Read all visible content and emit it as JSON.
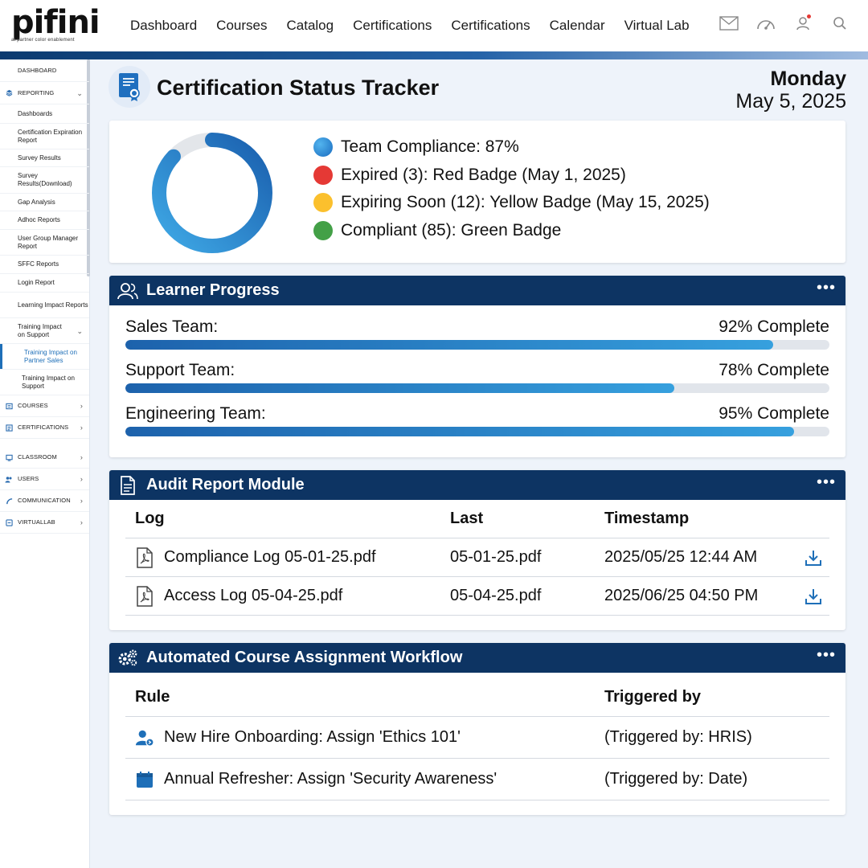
{
  "brand": {
    "logo": "pifini",
    "tagline": "at partner color enablement"
  },
  "nav": {
    "items": [
      "Dashboard",
      "Courses",
      "Catalog",
      "Certifications",
      "Certifications",
      "Calendar",
      "Virtual Lab"
    ],
    "icons": [
      "mail-icon",
      "gauge-icon",
      "user-icon",
      "search-icon"
    ]
  },
  "sidebar": {
    "items": [
      {
        "label": "DASHBOARD",
        "type": "section"
      },
      {
        "label": "REPORTING",
        "type": "section",
        "icon": "layers-icon",
        "chevron": "⌄"
      },
      {
        "label": "Dashboards",
        "type": "sub"
      },
      {
        "label": "Certification Expiration Report",
        "type": "sub"
      },
      {
        "label": "Survey Results",
        "type": "sub"
      },
      {
        "label": "Survey Results(Download)",
        "type": "sub"
      },
      {
        "label": "Gap Analysis",
        "type": "sub"
      },
      {
        "label": "Adhoc Reports",
        "type": "sub"
      },
      {
        "label": "User Group Manager Report",
        "type": "sub"
      },
      {
        "label": "SFFC Reports",
        "type": "sub"
      },
      {
        "label": "Login Report",
        "type": "sub"
      },
      {
        "label": "Learning Impact Reports",
        "type": "sub"
      },
      {
        "label": "Training Impact on Support",
        "type": "sub",
        "chevron": "⌄"
      },
      {
        "label": "Training Impact on Partner Sales",
        "type": "subsub",
        "active": true
      },
      {
        "label": "Training Impact on Support",
        "type": "subsub2"
      },
      {
        "label": "COURSES",
        "type": "section",
        "icon": "courses-icon",
        "chevron": "›"
      },
      {
        "label": "CERTIFICATIONS",
        "type": "section",
        "icon": "cert-icon",
        "chevron": "›"
      },
      {
        "label": "CLASSROOM",
        "type": "section",
        "icon": "classroom-icon",
        "chevron": "›"
      },
      {
        "label": "USERS",
        "type": "section",
        "icon": "users-icon",
        "chevron": "›"
      },
      {
        "label": "COMMUNICATION",
        "type": "section",
        "icon": "comm-icon",
        "chevron": "›"
      },
      {
        "label": "VIRTUALLAB",
        "type": "section",
        "icon": "lab-icon",
        "chevron": "›"
      }
    ]
  },
  "header": {
    "title": "Certification Status Tracker",
    "day": "Monday",
    "date": "May 5, 2025"
  },
  "compliance": {
    "percent": 87,
    "legend": [
      {
        "text": "Team Compliance: 87%",
        "color": "#1e7fcf"
      },
      {
        "text": "Expired (3): Red Badge (May 1, 2025)",
        "color": "#e53935"
      },
      {
        "text": "Expiring Soon (12): Yellow Badge (May 15, 2025)",
        "color": "#fbc02d"
      },
      {
        "text": "Compliant (85): Green Badge",
        "color": "#43a047"
      }
    ]
  },
  "progress": {
    "title": "Learner Progress",
    "rows": [
      {
        "team": "Sales Team:",
        "status": "92% Complete",
        "value": 92
      },
      {
        "team": "Support Team:",
        "status": "78% Complete",
        "value": 78
      },
      {
        "team": "Engineering Team:",
        "status": "95% Complete",
        "value": 95
      }
    ]
  },
  "audit": {
    "title": "Audit Report Module",
    "columns": [
      "Log",
      "Last",
      "Timestamp"
    ],
    "rows": [
      {
        "log": "Compliance Log 05-01-25.pdf",
        "last": "05-01-25.pdf",
        "timestamp": "2025/05/25 12:44 AM"
      },
      {
        "log": "Access Log 05-04-25.pdf",
        "last": "05-04-25.pdf",
        "timestamp": "2025/06/25 04:50 PM"
      }
    ]
  },
  "workflow": {
    "title": "Automated Course Assignment Workflow",
    "columns": [
      "Rule",
      "Triggered by"
    ],
    "rows": [
      {
        "rule": "New Hire Onboarding: Assign 'Ethics 101'",
        "trigger": "(Triggered by: HRIS)",
        "icon": "user-gear-icon"
      },
      {
        "rule": "Annual Refresher: Assign 'Security Awareness'",
        "trigger": "(Triggered by: Date)",
        "icon": "calendar-icon"
      }
    ]
  },
  "more_label": "•••",
  "colors": {
    "navy": "#0d3463",
    "accent": "#1e7fcf"
  }
}
